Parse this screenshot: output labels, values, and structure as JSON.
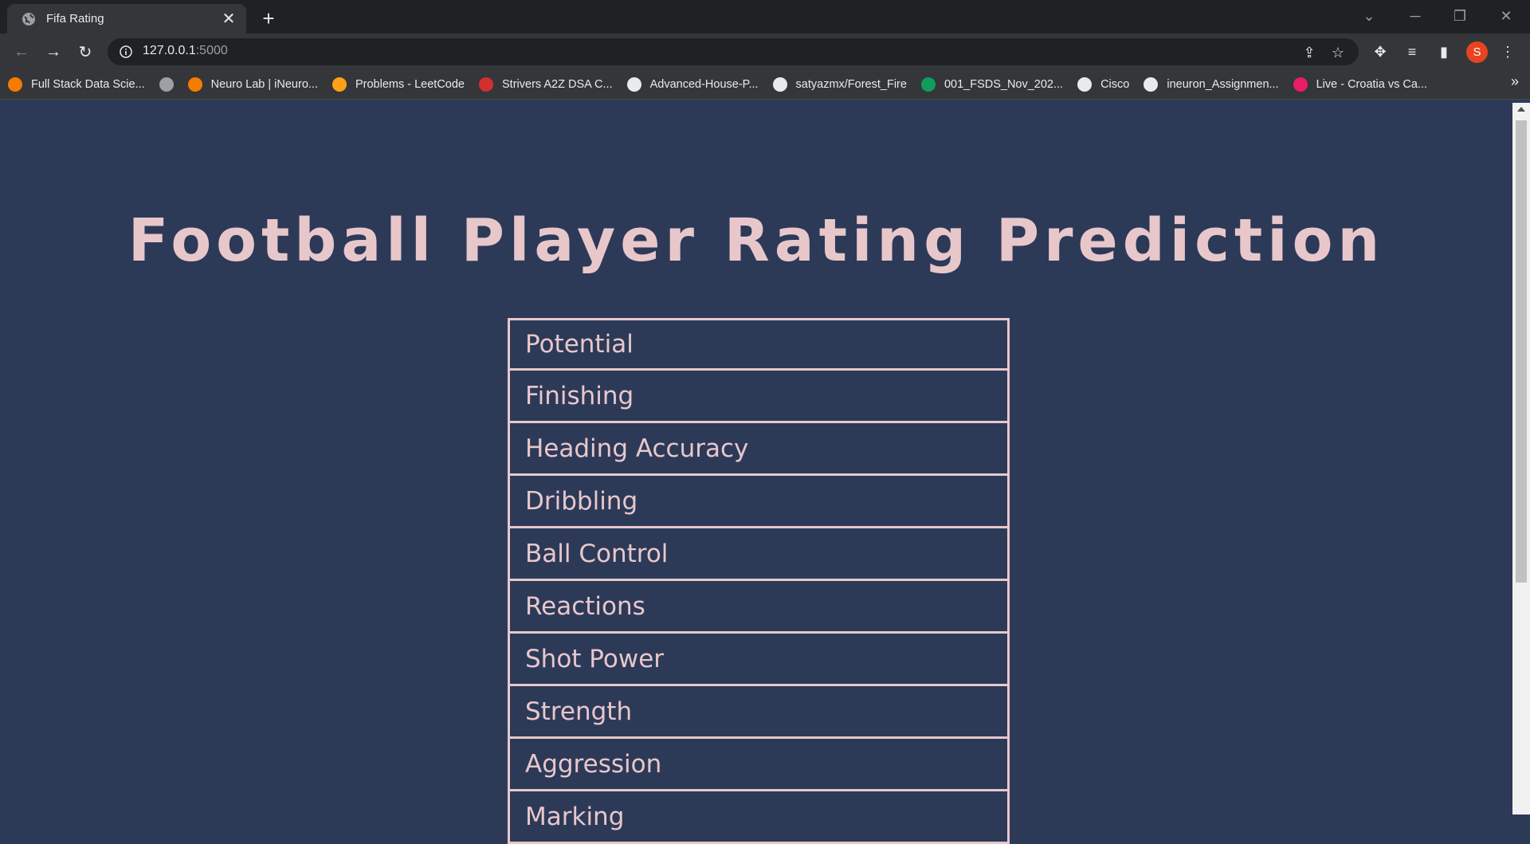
{
  "browser": {
    "tab_title": "Fifa Rating",
    "url_host": "127.0.0.1",
    "url_port": ":5000",
    "profile_initial": "S",
    "bookmarks": [
      {
        "label": "Full Stack Data Scie...",
        "icon": "ineuron-logo-icon",
        "color": "#f57c00"
      },
      {
        "label": "",
        "icon": "globe-icon",
        "color": "#9aa0a6"
      },
      {
        "label": "Neuro Lab | iNeuro...",
        "icon": "ineuron-logo-icon",
        "color": "#f57c00"
      },
      {
        "label": "Problems - LeetCode",
        "icon": "leetcode-icon",
        "color": "#ffa116"
      },
      {
        "label": "Strivers A2Z DSA C...",
        "icon": "tuf-icon",
        "color": "#d32f2f"
      },
      {
        "label": "Advanced-House-P...",
        "icon": "github-icon",
        "color": "#e8eaed"
      },
      {
        "label": "satyazmx/Forest_Fire",
        "icon": "github-icon",
        "color": "#e8eaed"
      },
      {
        "label": "001_FSDS_Nov_202...",
        "icon": "sheets-icon",
        "color": "#0f9d58"
      },
      {
        "label": "Cisco",
        "icon": "cisco-icon",
        "color": "#e8eaed"
      },
      {
        "label": "ineuron_Assignmen...",
        "icon": "github-icon",
        "color": "#e8eaed"
      },
      {
        "label": "Live - Croatia vs Ca...",
        "icon": "live-icon",
        "color": "#e91e63"
      }
    ]
  },
  "page": {
    "heading": "Football Player Rating Prediction",
    "fields": [
      {
        "placeholder": "Potential"
      },
      {
        "placeholder": "Finishing"
      },
      {
        "placeholder": "Heading Accuracy"
      },
      {
        "placeholder": "Dribbling"
      },
      {
        "placeholder": "Ball Control"
      },
      {
        "placeholder": "Reactions"
      },
      {
        "placeholder": "Shot Power"
      },
      {
        "placeholder": "Strength"
      },
      {
        "placeholder": "Aggression"
      },
      {
        "placeholder": "Marking"
      }
    ]
  },
  "colors": {
    "page_bg": "#2c3a58",
    "accent": "#e8c7cb"
  }
}
